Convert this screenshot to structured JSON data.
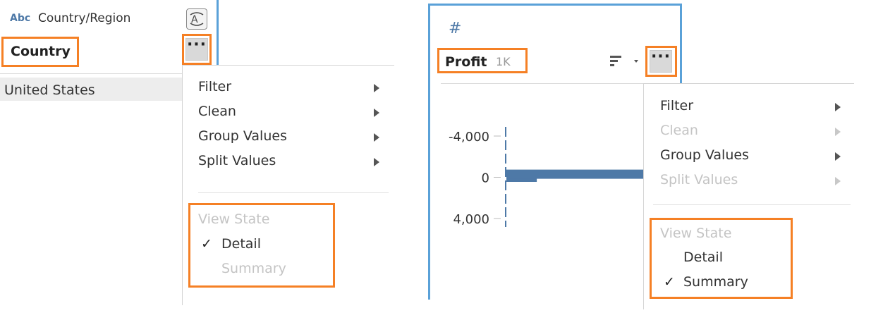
{
  "left": {
    "type_badge": "Abc",
    "field_name": "Country/Region",
    "field_label": "Country",
    "value_row": "United States",
    "menu": {
      "items": [
        {
          "label": "Filter"
        },
        {
          "label": "Clean"
        },
        {
          "label": "Group Values"
        },
        {
          "label": "Split Values"
        }
      ],
      "view_state_label": "View State",
      "options": [
        {
          "label": "Detail",
          "checked": true
        },
        {
          "label": "Summary",
          "checked": false
        }
      ]
    }
  },
  "right": {
    "type_badge": "#",
    "field_label": "Profit",
    "count": "1K",
    "menu": {
      "items": [
        {
          "label": "Filter",
          "enabled": true
        },
        {
          "label": "Clean",
          "enabled": false
        },
        {
          "label": "Group Values",
          "enabled": true
        },
        {
          "label": "Split Values",
          "enabled": false
        }
      ],
      "view_state_label": "View State",
      "options": [
        {
          "label": "Detail",
          "checked": false
        },
        {
          "label": "Summary",
          "checked": true
        }
      ]
    }
  },
  "more_label": "···",
  "checkmark": "✓",
  "chart_data": {
    "type": "bar",
    "orientation": "horizontal",
    "y_tick_labels": [
      "-4,000",
      "0",
      "4,000"
    ],
    "ylim": [
      -4000,
      4000
    ],
    "bars": [
      {
        "bin_center": 0,
        "relative_length": 0.22
      },
      {
        "bin_center": -300,
        "relative_length": 1.0
      }
    ],
    "color": "#4e79a7"
  },
  "colors": {
    "highlight": "#f58025",
    "card_border": "#5aa1d8",
    "bar": "#4e79a7"
  }
}
